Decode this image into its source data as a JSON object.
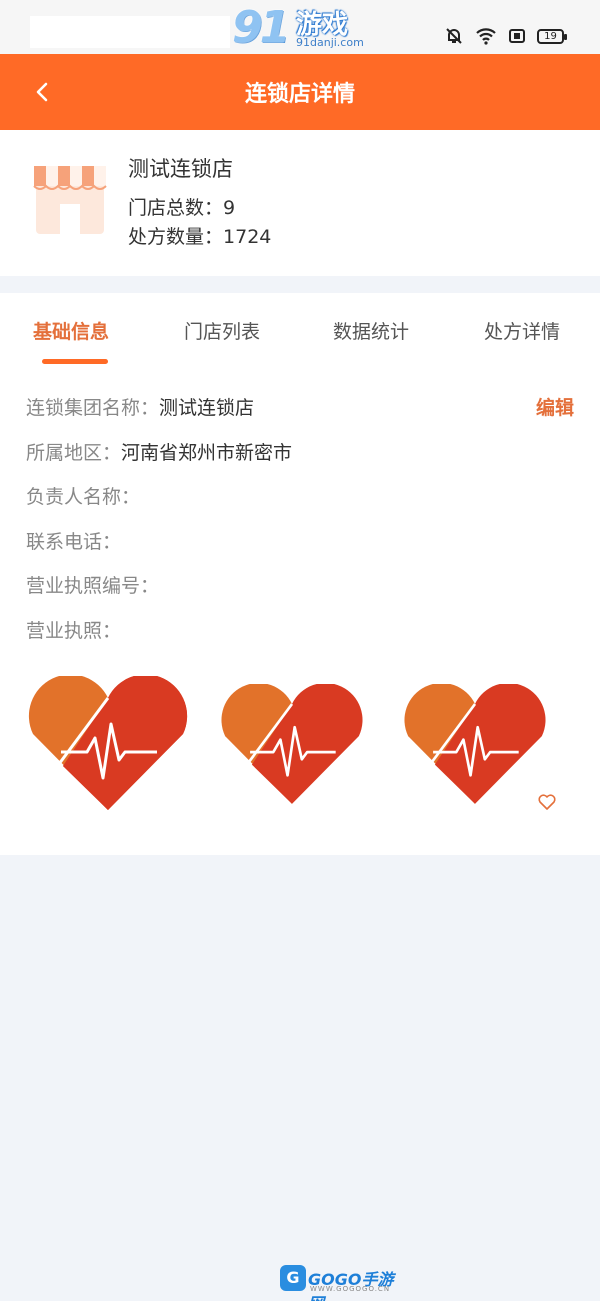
{
  "status_bar": {
    "watermark_brand": "91",
    "watermark_title": "游戏",
    "watermark_url": "91danji.com",
    "battery_level": "19",
    "icons": [
      "bell-off-icon",
      "wifi-icon",
      "sim-icon",
      "battery-icon"
    ]
  },
  "header": {
    "title": "连锁店详情",
    "back_icon": "chevron-left-icon"
  },
  "store": {
    "name": "测试连锁店",
    "store_count_label": "门店总数：",
    "store_count": "9",
    "prescription_count_label": "处方数量：",
    "prescription_count": "1724",
    "icon": "storefront-icon"
  },
  "tabs": [
    {
      "label": "基础信息",
      "active": true
    },
    {
      "label": "门店列表",
      "active": false
    },
    {
      "label": "数据统计",
      "active": false
    },
    {
      "label": "处方详情",
      "active": false
    }
  ],
  "info": {
    "edit_label": "编辑",
    "rows": [
      {
        "label": "连锁集团名称：",
        "value": "测试连锁店"
      },
      {
        "label": "所属地区：",
        "value": "河南省郑州市新密市"
      },
      {
        "label": "负责人名称：",
        "value": ""
      },
      {
        "label": "联系电话：",
        "value": ""
      },
      {
        "label": "营业执照编号：",
        "value": ""
      },
      {
        "label": "营业执照：",
        "value": ""
      }
    ]
  },
  "license_images": [
    "heart-ecg-image",
    "heart-ecg-image",
    "heart-ecg-image"
  ],
  "footer_watermark": {
    "logo": "G",
    "text": "GOGO手游网",
    "url": "WWW.GOGOGO.CN"
  },
  "colors": {
    "primary": "#ff6a26",
    "accent_text": "#e4703b",
    "background": "#f1f4f9",
    "heart_left": "#e2722a",
    "heart_right": "#d93a22"
  }
}
